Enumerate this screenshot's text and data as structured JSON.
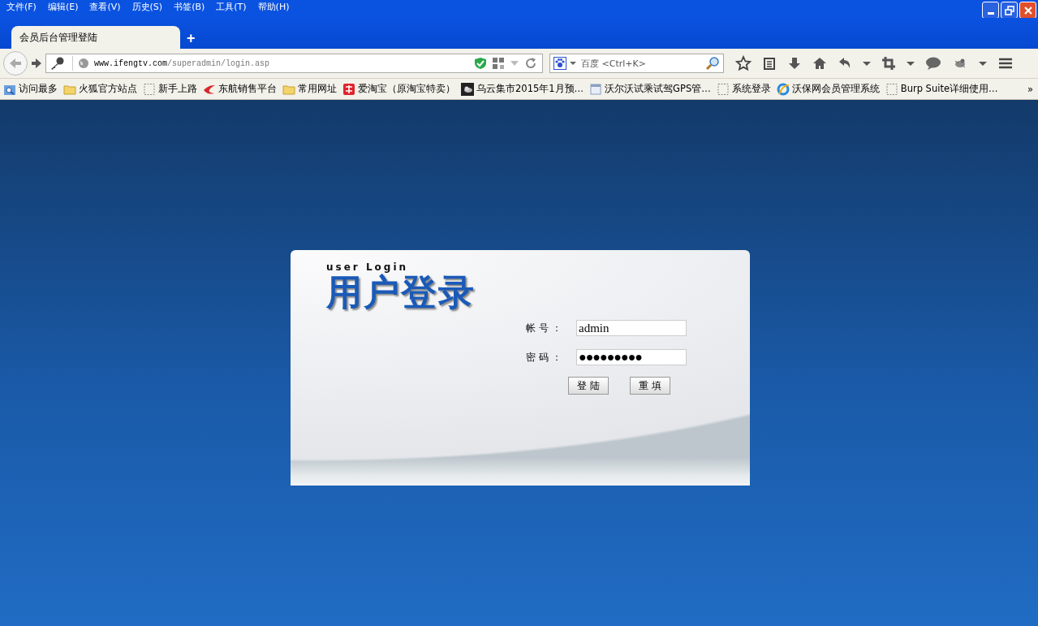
{
  "menu": [
    "文件(F)",
    "编辑(E)",
    "查看(V)",
    "历史(S)",
    "书签(B)",
    "工具(T)",
    "帮助(H)"
  ],
  "tabs": [
    {
      "label": "会员后台管理登陆",
      "selected": true
    }
  ],
  "new_tab": "+",
  "address": {
    "host": "www.ifengtv.com",
    "path": "/superadmin/login.asp"
  },
  "search": {
    "placeholder": "百度 <Ctrl+K>"
  },
  "bookmarks": [
    {
      "label": "访问最多",
      "kind": "history"
    },
    {
      "label": "火狐官方站点",
      "kind": "folder"
    },
    {
      "label": "新手上路",
      "kind": "blank"
    },
    {
      "label": "东航销售平台",
      "kind": "bird"
    },
    {
      "label": "常用网址",
      "kind": "folder"
    },
    {
      "label": "爱淘宝（原淘宝特卖）",
      "kind": "tao"
    },
    {
      "label": "乌云集市2015年1月预…",
      "kind": "cloud"
    },
    {
      "label": "沃尔沃试乘试驾GPS管…",
      "kind": "page"
    },
    {
      "label": "系统登录",
      "kind": "blank"
    },
    {
      "label": "沃保网会员管理系统",
      "kind": "ie"
    },
    {
      "label": "Burp Suite详细使用…",
      "kind": "blank"
    }
  ],
  "bookmarks_more": "»",
  "login": {
    "subtitle": "user Login",
    "title": "用户登录",
    "fields": [
      {
        "label": "帐 号 ：",
        "value": "admin",
        "kind": "text"
      },
      {
        "label": "密 码 ：",
        "value": "●●●●●●●●●",
        "kind": "password"
      }
    ],
    "buttons": [
      "登 陆",
      "重 填"
    ]
  }
}
